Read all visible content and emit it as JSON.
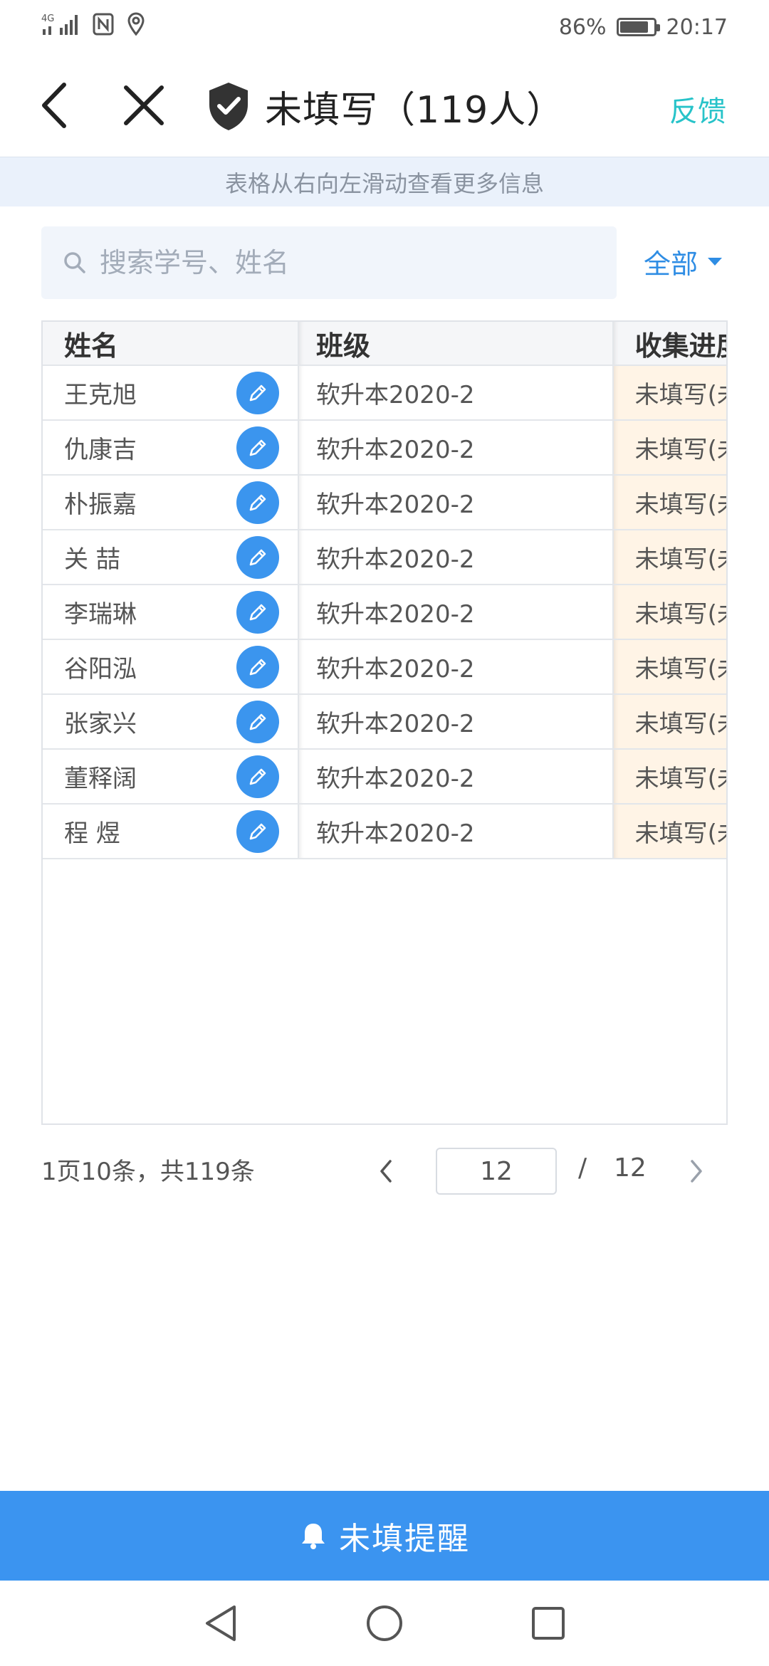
{
  "status_bar": {
    "network": "4G",
    "battery_percent": "86%",
    "battery_level": 0.86,
    "time": "20:17",
    "icons": [
      "signal-icon",
      "nfc-icon",
      "location-icon",
      "battery-icon"
    ]
  },
  "header": {
    "title": "未填写（119人）",
    "feedback_label": "反馈",
    "icons": [
      "back-icon",
      "close-icon",
      "shield-check-icon"
    ]
  },
  "hint": "表格从右向左滑动查看更多信息",
  "search": {
    "placeholder": "搜索学号、姓名",
    "value": "",
    "icon": "search-icon"
  },
  "filter": {
    "selected": "全部",
    "icon": "caret-down-icon"
  },
  "table": {
    "columns": [
      "姓名",
      "班级",
      "收集进度"
    ],
    "rows": [
      {
        "name": "王克旭",
        "class": "软升本2020-2",
        "progress": "未填写(未"
      },
      {
        "name": "仇康吉",
        "class": "软升本2020-2",
        "progress": "未填写(未"
      },
      {
        "name": "朴振嘉",
        "class": "软升本2020-2",
        "progress": "未填写(未"
      },
      {
        "name": "关 喆",
        "class": "软升本2020-2",
        "progress": "未填写(未"
      },
      {
        "name": "李瑞琳",
        "class": "软升本2020-2",
        "progress": "未填写(未"
      },
      {
        "name": "谷阳泓",
        "class": "软升本2020-2",
        "progress": "未填写(未"
      },
      {
        "name": "张家兴",
        "class": "软升本2020-2",
        "progress": "未填写(未"
      },
      {
        "name": "董释阔",
        "class": "软升本2020-2",
        "progress": "未填写(未"
      },
      {
        "name": "程 煜",
        "class": "软升本2020-2",
        "progress": "未填写(未"
      }
    ]
  },
  "pagination": {
    "summary": "1页10条，共119条",
    "current_page": "12",
    "separator": "/",
    "total_pages": "12"
  },
  "remind_button": {
    "label": "未填提醒",
    "icon": "bell-icon"
  },
  "nav_bar": {
    "icons": [
      "nav-back-icon",
      "nav-home-icon",
      "nav-recents-icon"
    ]
  },
  "colors": {
    "accent_blue": "#3b94f0",
    "feedback_teal": "#27c3c9",
    "hint_bg": "#eaf1fb",
    "progress_bg": "#fff4e6"
  }
}
